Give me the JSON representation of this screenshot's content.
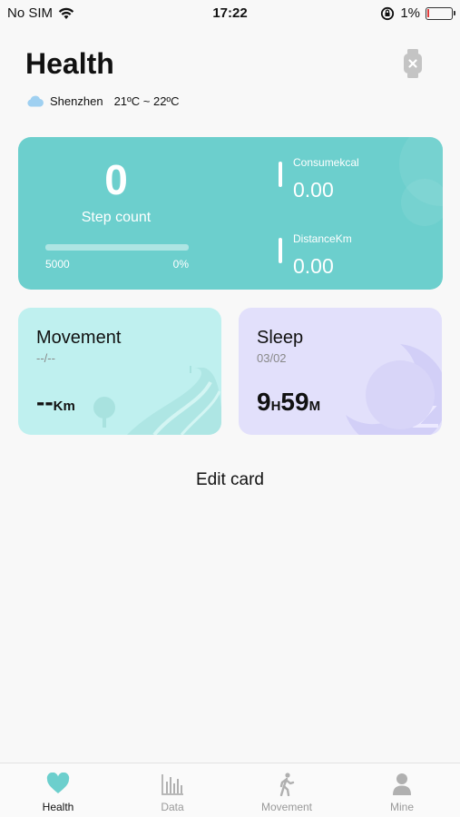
{
  "status_bar": {
    "carrier": "No SIM",
    "time": "17:22",
    "battery": "1%"
  },
  "page": {
    "title": "Health"
  },
  "weather": {
    "city": "Shenzhen",
    "temperature": "21ºC ~ 22ºC",
    "icon": "cloud-icon"
  },
  "steps": {
    "value": "0",
    "label": "Step count",
    "goal": "5000",
    "progress_label": "0%",
    "progress_fraction": 0
  },
  "metrics": {
    "kcal_label": "Consumekcal",
    "kcal_value": "0.00",
    "distance_label": "DistanceKm",
    "distance_value": "0.00"
  },
  "movement_card": {
    "title": "Movement",
    "date": "--/--",
    "value": "--",
    "unit": "Km"
  },
  "sleep_card": {
    "title": "Sleep",
    "date": "03/02",
    "hours": "9",
    "hours_unit": "H",
    "minutes": "59",
    "minutes_unit": "M"
  },
  "edit_card_label": "Edit card",
  "tabs": [
    {
      "label": "Health",
      "icon": "heart-icon",
      "active": true
    },
    {
      "label": "Data",
      "icon": "bar-chart-icon",
      "active": false
    },
    {
      "label": "Movement",
      "icon": "walking-icon",
      "active": false
    },
    {
      "label": "Mine",
      "icon": "person-icon",
      "active": false
    }
  ],
  "colors": {
    "accent": "#6ccfcd",
    "movement_card": "#bff0ef",
    "sleep_card": "#e2e0fb",
    "battery_low": "#e23c3c"
  }
}
